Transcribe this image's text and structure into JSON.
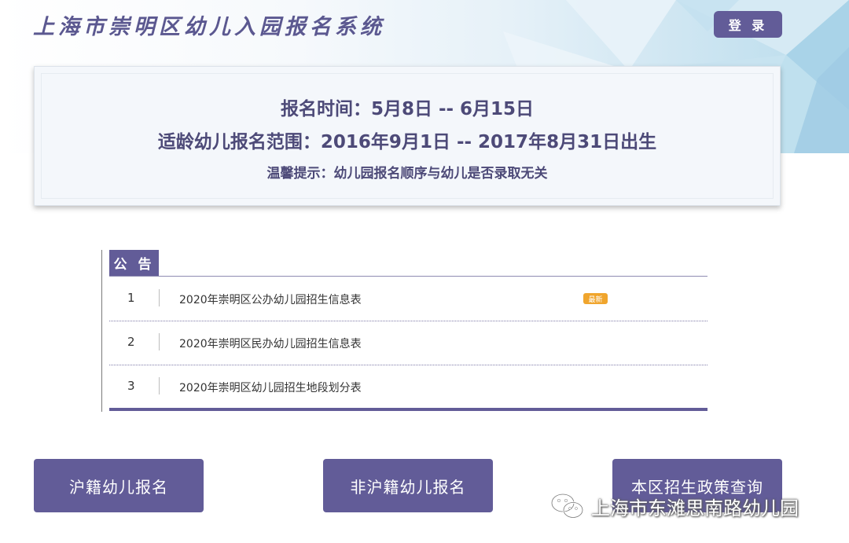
{
  "header": {
    "site_title": "上海市崇明区幼儿入园报名系统",
    "login_label": "登 录"
  },
  "info": {
    "registration_period": "报名时间：5月8日 -- 6月15日",
    "eligible_range": "适龄幼儿报名范围：2016年9月1日 -- 2017年8月31日出生",
    "reminder": "温馨提示：幼儿园报名顺序与幼儿是否录取无关"
  },
  "notice": {
    "tab_label": "公 告",
    "items": [
      {
        "num": "1",
        "text": "2020年崇明区公办幼儿园招生信息表",
        "badge": "最新"
      },
      {
        "num": "2",
        "text": "2020年崇明区民办幼儿园招生信息表"
      },
      {
        "num": "3",
        "text": "2020年崇明区幼儿园招生地段划分表"
      }
    ]
  },
  "actions": {
    "local_registration": "沪籍幼儿报名",
    "nonlocal_registration": "非沪籍幼儿报名",
    "policy_query": "本区招生政策查询"
  },
  "watermark": {
    "text": "上海市东滩思南路幼儿园",
    "icon": "wechat-icon"
  },
  "colors": {
    "accent": "#625c98",
    "text_dark": "#4d4a78",
    "badge": "#f0a52d"
  }
}
